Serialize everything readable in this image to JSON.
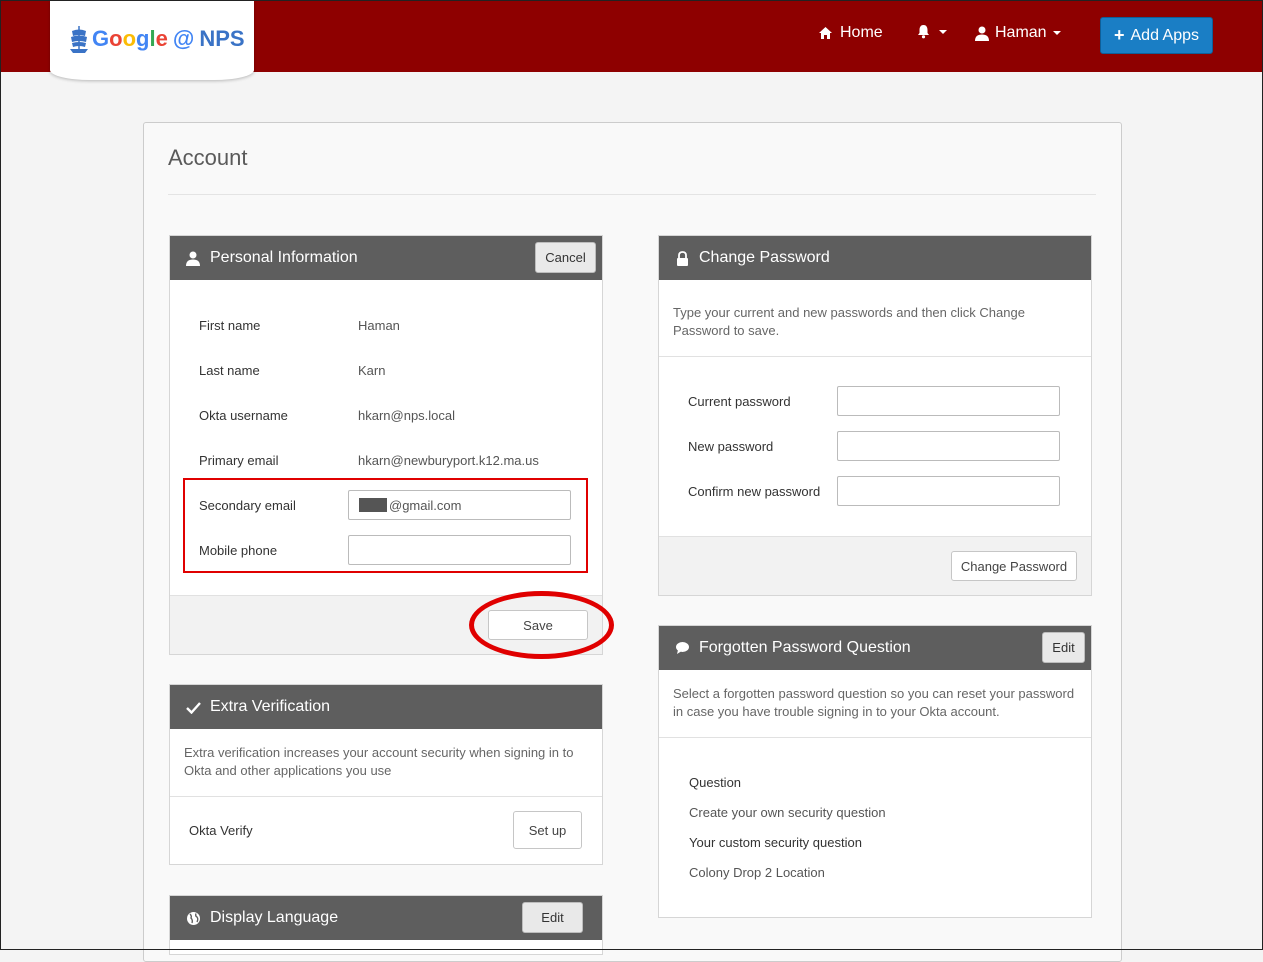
{
  "header": {
    "logo": {
      "google": [
        "G",
        "o",
        "o",
        "g",
        "l",
        "e"
      ],
      "at": "@",
      "org": "NPS"
    },
    "nav": {
      "home": "Home",
      "user": "Haman"
    },
    "add_apps": "Add Apps"
  },
  "page": {
    "title": "Account"
  },
  "personal": {
    "title": "Personal Information",
    "cancel": "Cancel",
    "first_name_label": "First name",
    "first_name": "Haman",
    "last_name_label": "Last name",
    "last_name": "Karn",
    "okta_username_label": "Okta username",
    "okta_username": "hkarn@nps.local",
    "primary_email_label": "Primary email",
    "primary_email": "hkarn@newburyport.k12.ma.us",
    "secondary_email_label": "Secondary email",
    "secondary_email_suffix": "@gmail.com",
    "mobile_phone_label": "Mobile phone",
    "mobile_phone": "",
    "save": "Save"
  },
  "extra_verification": {
    "title": "Extra Verification",
    "description": "Extra verification increases your account security when signing in to Okta and other applications you use",
    "okta_verify_label": "Okta Verify",
    "setup": "Set up"
  },
  "display_language": {
    "title": "Display Language",
    "edit": "Edit"
  },
  "change_password": {
    "title": "Change Password",
    "description": "Type your current and new passwords and then click Change Password to save.",
    "current_label": "Current password",
    "new_label": "New password",
    "confirm_label": "Confirm new password",
    "submit": "Change Password"
  },
  "forgotten_question": {
    "title": "Forgotten Password Question",
    "edit": "Edit",
    "description": "Select a forgotten password question so you can reset your password in case you have trouble signing in to your Okta account.",
    "question_label": "Question",
    "question_value": "Create your own security question",
    "custom_label": "Your custom security question",
    "custom_value": "Colony Drop 2 Location"
  },
  "colors": {
    "topbar": "#8e0000",
    "accent": "#1a7ec5",
    "panel_head": "#5e5e5e",
    "highlight": "#e00000"
  }
}
